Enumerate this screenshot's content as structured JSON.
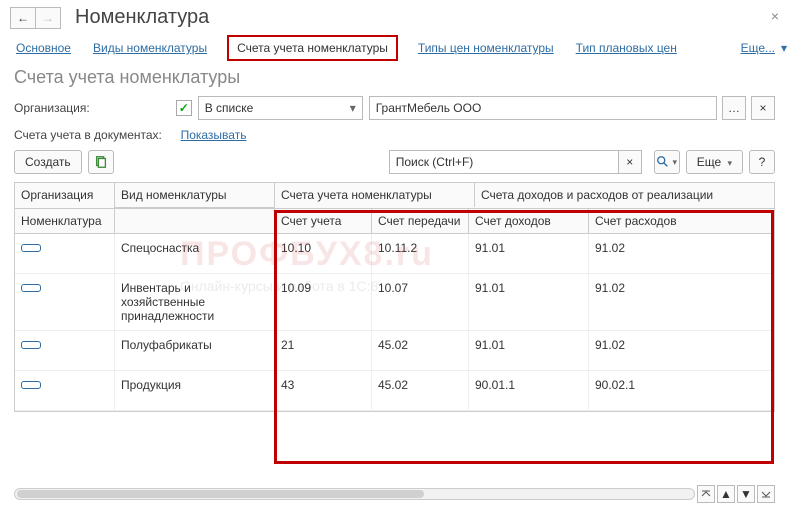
{
  "header": {
    "title": "Номенклатура"
  },
  "tabs": {
    "main": "Основное",
    "kinds": "Виды номенклатуры",
    "accounts": "Счета учета номенклатуры",
    "price_types": "Типы цен номенклатуры",
    "plan_prices": "Тип плановых цен",
    "more": "Еще..."
  },
  "subtitle": "Счета учета номенклатуры",
  "filter": {
    "org_label": "Организация:",
    "mode": "В списке",
    "org_value": "ГрантМебель ООО",
    "docs_label": "Счета учета в документах:",
    "docs_link": "Показывать"
  },
  "toolbar": {
    "create": "Создать",
    "search_placeholder": "Поиск (Ctrl+F)",
    "more": "Еще"
  },
  "grid": {
    "h_org": "Организация",
    "h_kind": "Вид номенклатуры",
    "h_accounts": "Счета учета номенклатуры",
    "h_income": "Счета доходов и расходов от реализации",
    "h_nom": "Номенклатура",
    "h_acc": "Счет учета",
    "h_transfer": "Счет передачи",
    "h_inc": "Счет доходов",
    "h_exp": "Счет расходов",
    "rows": [
      {
        "kind": "Спецоснастка",
        "acc": "10.10",
        "transfer": "10.11.2",
        "inc": "91.01",
        "exp": "91.02"
      },
      {
        "kind": "Инвентарь и хозяйственные принадлежности",
        "acc": "10.09",
        "transfer": "10.07",
        "inc": "91.01",
        "exp": "91.02"
      },
      {
        "kind": "Полуфабрикаты",
        "acc": "21",
        "transfer": "45.02",
        "inc": "91.01",
        "exp": "91.02"
      },
      {
        "kind": "Продукция",
        "acc": "43",
        "transfer": "45.02",
        "inc": "90.01.1",
        "exp": "90.02.1"
      }
    ]
  }
}
